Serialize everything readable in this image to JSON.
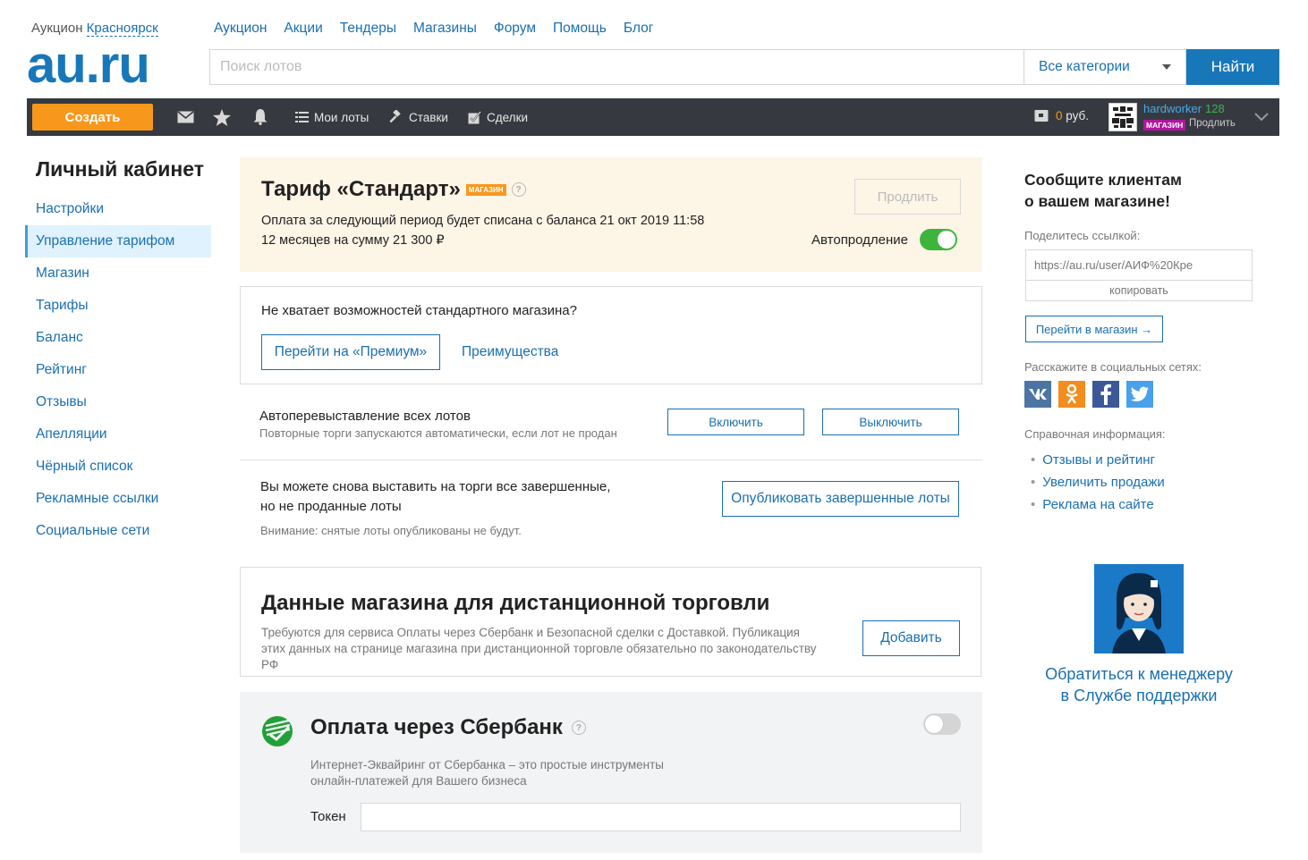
{
  "header": {
    "city_prefix": "Аукцион",
    "city": "Красноярск",
    "logo": "au.ru",
    "nav": [
      "Аукцион",
      "Акции",
      "Тендеры",
      "Магазины",
      "Форум",
      "Помощь",
      "Блог"
    ],
    "search_placeholder": "Поиск лотов",
    "category": "Все категории",
    "search_button": "Найти"
  },
  "toolbar": {
    "create": "Создать",
    "icons": [
      "mail-icon",
      "star-icon",
      "bell-icon"
    ],
    "my_lots": "Мои лоты",
    "bids": "Ставки",
    "deals": "Сделки",
    "balance_value": "0",
    "balance_unit": "руб.",
    "username": "hardworker",
    "rating": "128",
    "shop_badge": "МАГАЗИН",
    "prolong": "Продлить"
  },
  "sidebar": {
    "title": "Личный кабинет",
    "items": [
      {
        "label": "Настройки",
        "active": false
      },
      {
        "label": "Управление тарифом",
        "active": true
      },
      {
        "label": "Магазин",
        "active": false
      },
      {
        "label": "Тарифы",
        "active": false
      },
      {
        "label": "Баланс",
        "active": false
      },
      {
        "label": "Рейтинг",
        "active": false
      },
      {
        "label": "Отзывы",
        "active": false
      },
      {
        "label": "Апелляции",
        "active": false
      },
      {
        "label": "Чёрный список",
        "active": false
      },
      {
        "label": "Рекламные ссылки",
        "active": false
      },
      {
        "label": "Социальные сети",
        "active": false
      }
    ]
  },
  "tariff": {
    "title": "Тариф «Стандарт»",
    "badge": "МАГАЗИН",
    "help": "?",
    "line1": "Оплата за следующий период будет списана с баланса 21 окт 2019 11:58",
    "line2": "12 месяцев на сумму 21 300 ₽",
    "renew_button": "Продлить",
    "auto_label": "Автопродление",
    "auto_enabled": true
  },
  "premium": {
    "question": "Не хватает возможностей стандартного магазина?",
    "button": "Перейти на «Премиум»",
    "advantages": "Преимущества"
  },
  "relist": {
    "title": "Автоперевыставление всех лотов",
    "subtitle": "Повторные торги запускаются автоматически, если лот не продан",
    "enable": "Включить",
    "disable": "Выключить"
  },
  "republish": {
    "line1": "Вы можете снова выставить на торги все завершенные,",
    "line2": "но не проданные лоты",
    "note": "Внимание: снятые лоты опубликованы не будут.",
    "button": "Опубликовать завершенные лоты"
  },
  "distance": {
    "title": "Данные магазина для дистанционной торговли",
    "description": "Требуются для сервиса Оплаты через Сбербанк и Безопасной сделки с Доставкой. Публикация этих данных на странице магазина при дистанционной торговле обязательно по законодательству РФ",
    "button": "Добавить"
  },
  "sber": {
    "title": "Оплата через Сбербанк",
    "help": "?",
    "enabled": false,
    "desc_line1": "Интернет-Эквайринг от Сбербанка – это простые инструменты",
    "desc_line2": "онлайн-платежей для Вашего бизнеса",
    "token_label": "Токен",
    "token_value": ""
  },
  "right": {
    "title_line1": "Сообщите клиентам",
    "title_line2": "о вашем магазине!",
    "share_label": "Поделитесь ссылкой:",
    "share_url": "https://au.ru/user/АИФ%20Кре",
    "copy": "копировать",
    "goto_shop": "Перейти в магазин →",
    "social_label": "Расскажите в социальных сетях:",
    "help_label": "Справочная информация:",
    "help_links": [
      "Отзывы и рейтинг",
      "Увеличить продажи",
      "Реклама на сайте"
    ],
    "manager_line1": "Обратиться к менеджеру",
    "manager_line2": "в Службе поддержки"
  },
  "colors": {
    "brand": "#1877b8",
    "link": "#1a6fb0",
    "create": "#f7981d",
    "toolbar": "#363a40",
    "tariff_bg": "#fdf5e6",
    "toggle_on": "#3db53d",
    "shop_badge": "#b1169f"
  }
}
